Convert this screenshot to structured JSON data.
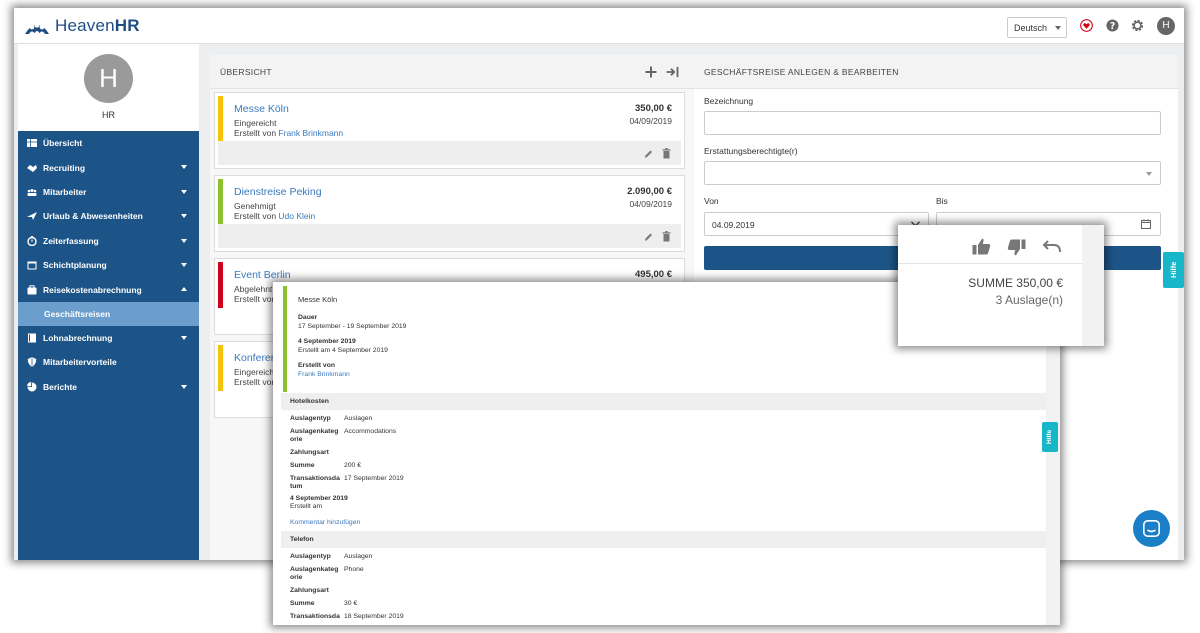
{
  "app": {
    "logo_left": "Heaven",
    "logo_right": "HR",
    "language": "Deutsch",
    "user_initial": "H",
    "user_name": "HR"
  },
  "colors": {
    "brand": "#1d5488",
    "brand_sub": "#6b9ecd",
    "accent": "#17b7c9",
    "link": "#3a7abf",
    "yellow": "#f5c400",
    "green": "#8cc22f",
    "red": "#d0021b"
  },
  "sidebar": {
    "items": [
      {
        "label": "Übersicht",
        "icon": "dashboard-icon"
      },
      {
        "label": "Recruiting",
        "icon": "handshake-icon"
      },
      {
        "label": "Mitarbeiter",
        "icon": "people-icon"
      },
      {
        "label": "Urlaub & Abwesenheiten",
        "icon": "plane-icon"
      },
      {
        "label": "Zeiterfassung",
        "icon": "stopwatch-icon"
      },
      {
        "label": "Schichtplanung",
        "icon": "calendar-icon"
      },
      {
        "label": "Reisekostenabrechnung",
        "icon": "briefcase-icon"
      },
      {
        "label": "Lohnabrechnung",
        "icon": "book-icon"
      },
      {
        "label": "Mitarbeitervorteile",
        "icon": "shield-icon"
      },
      {
        "label": "Berichte",
        "icon": "pie-chart-icon"
      }
    ],
    "sub_item": "Geschäftsreisen"
  },
  "overview": {
    "title": "ÜBERSICHT",
    "cards": [
      {
        "title": "Messe Köln",
        "status": "Eingereicht",
        "by_prefix": "Erstellt von",
        "by_name": "Frank Brinkmann",
        "amount": "350,00 €",
        "date": "04/09/2019"
      },
      {
        "title": "Dienstreise Peking",
        "status": "Genehmigt",
        "by_prefix": "Erstellt von",
        "by_name": "Udo Klein",
        "amount": "2.090,00 €",
        "date": "04/09/2019"
      },
      {
        "title": "Event Berlin",
        "status": "Abgelehnt",
        "by_prefix": "Erstellt von",
        "amount": "495,00 €"
      },
      {
        "title": "Konferen",
        "status": "Eingereicht",
        "by_prefix": "Erstellt von"
      }
    ]
  },
  "form": {
    "title": "GESCHÄFTSREISE ANLEGEN & BEARBEITEN",
    "label_bezeichnung": "Bezeichnung",
    "label_erstattung": "Erstattungsberechtigte(r)",
    "label_von": "Von",
    "label_bis": "Bis",
    "von_value": "04.09.2019",
    "hilfe": "Hilfe"
  },
  "popup": {
    "summe": "SUMME 350,00 €",
    "auslagen": "3 Auslage(n)"
  },
  "detail": {
    "title": "Messe Köln",
    "dauer_label": "Dauer",
    "dauer_value": "17 September - 19 September 2019",
    "created_date": "4 September 2019",
    "created_note": "Erstellt am 4 September 2019",
    "by_label": "Erstellt von",
    "by_name": "Frank Brinkmann",
    "hilfe": "Hilfe",
    "sections": [
      {
        "title": "Hotelkosten",
        "typ_label": "Auslagentyp",
        "typ_value": "Auslagen",
        "kat_label_1": "Auslagenkateg",
        "kat_label_2": "orie",
        "kat_value": "Accommodations",
        "zahl_label": "Zahlungsart",
        "summe_label": "Summe",
        "summe_value": "200 €",
        "trans_label_1": "Transaktionsda",
        "trans_label_2": "tum",
        "trans_value": "17 September 2019",
        "comment_date": "4 September 2019",
        "comment_note": "Erstellt am",
        "comment_link": "Kommentar hinzufügen"
      },
      {
        "title": "Telefon",
        "typ_label": "Auslagentyp",
        "typ_value": "Auslagen",
        "kat_label_1": "Auslagenkateg",
        "kat_label_2": "orie",
        "kat_value": "Phone",
        "zahl_label": "Zahlungsart",
        "summe_label": "Summe",
        "summe_value": "30 €",
        "trans_label_1": "Transaktionsda",
        "trans_value": "18 September 2019"
      }
    ]
  }
}
